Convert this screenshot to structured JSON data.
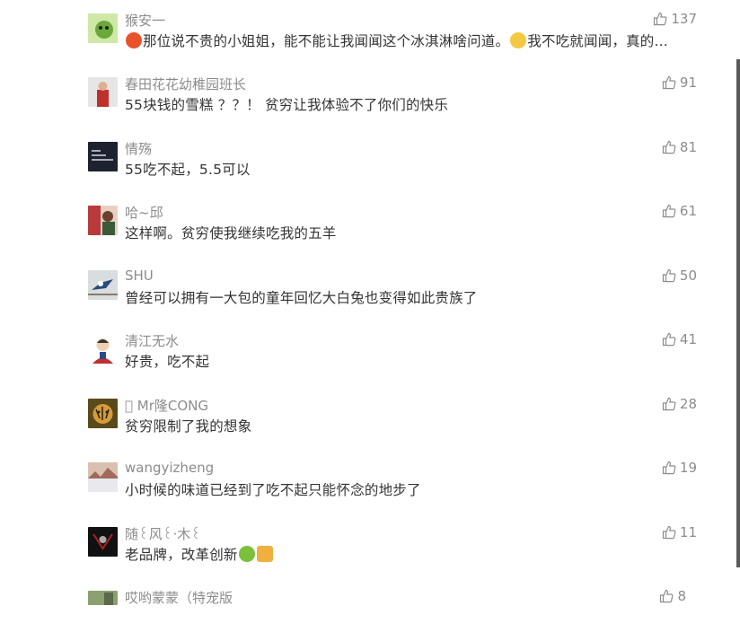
{
  "comments": [
    {
      "user": "猴安一",
      "pre": "",
      "mid": "那位说不贵的小姐姐，能不能让我闻闻这个冰淇淋啥问道。",
      "post": "我不吃就闻闻，真的...",
      "likes": "137",
      "avatar_color": "#7bb54a"
    },
    {
      "user": "春田花花幼稚园班长",
      "text": "55块钱的雪糕 ？？！ 贫穷让我体验不了你们的快乐",
      "likes": "91",
      "avatar_color": "#c0302a"
    },
    {
      "user": "情殇",
      "text": "55吃不起，5.5可以",
      "likes": "81",
      "avatar_color": "#1d2230"
    },
    {
      "user": "哈~邱",
      "text": "这样啊。贫穷使我继续吃我的五羊",
      "likes": "61",
      "avatar_color": "#b83a3a"
    },
    {
      "user": "SHU",
      "text": "曾经可以拥有一大包的童年回忆大白兔也变得如此贵族了",
      "likes": "50",
      "avatar_color": "#6a8fa8"
    },
    {
      "user": "清江无水",
      "text": "好贵，吃不起",
      "likes": "41",
      "avatar_color": "#f0e6dc"
    },
    {
      "user": "󰀀 Mr隆CONG",
      "text": "贫穷限制了我的想象",
      "likes": "28",
      "avatar_color": "#8a6a2a"
    },
    {
      "user": "wangyizheng",
      "text": "小时候的味道已经到了吃不起只能怀念的地步了",
      "likes": "19",
      "avatar_color": "#d9b9a0"
    },
    {
      "user": "随꒰风꒰·木꒰",
      "text": "老品牌，改革创新",
      "likes": "11",
      "avatar_color": "#111111"
    },
    {
      "user": "哎哟蒙蒙（特宠版",
      "text": "",
      "likes": "8",
      "avatar_color": "#8aa070"
    }
  ],
  "colors": {
    "accent": "#8c8c8c",
    "text": "#333333",
    "username": "#8c8c8c"
  },
  "icons": {
    "like": "thumbs-up-icon"
  }
}
